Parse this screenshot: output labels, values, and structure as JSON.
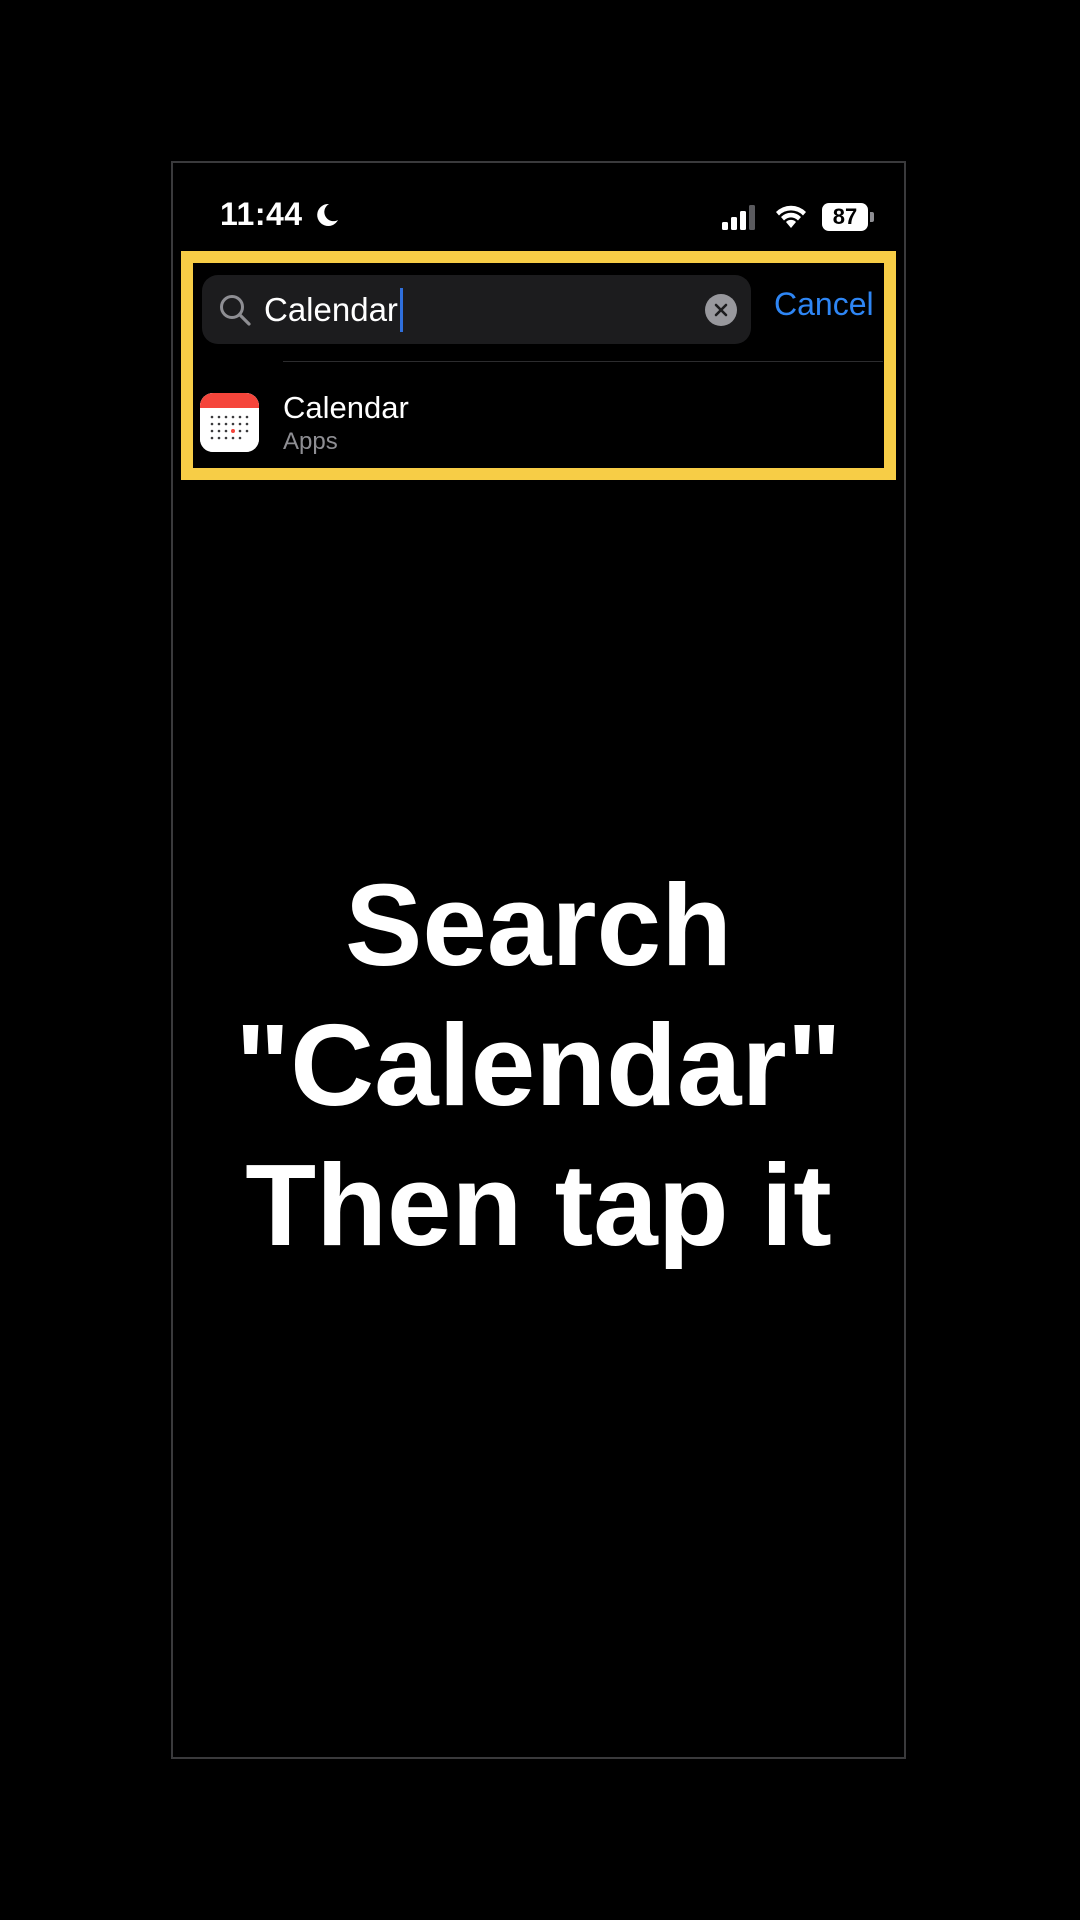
{
  "status_bar": {
    "time": "11:44",
    "battery": "87"
  },
  "search": {
    "query": "Calendar",
    "cancel_label": "Cancel"
  },
  "results": [
    {
      "title": "Calendar",
      "subtitle": "Apps",
      "icon": "calendar-app-icon"
    }
  ],
  "instruction": {
    "line1": "Search",
    "line2": "\"Calendar\"",
    "line3": "Then tap it"
  },
  "colors": {
    "highlight": "#f7cd46",
    "accent": "#2e86f5",
    "calendar_red": "#f5453b"
  }
}
